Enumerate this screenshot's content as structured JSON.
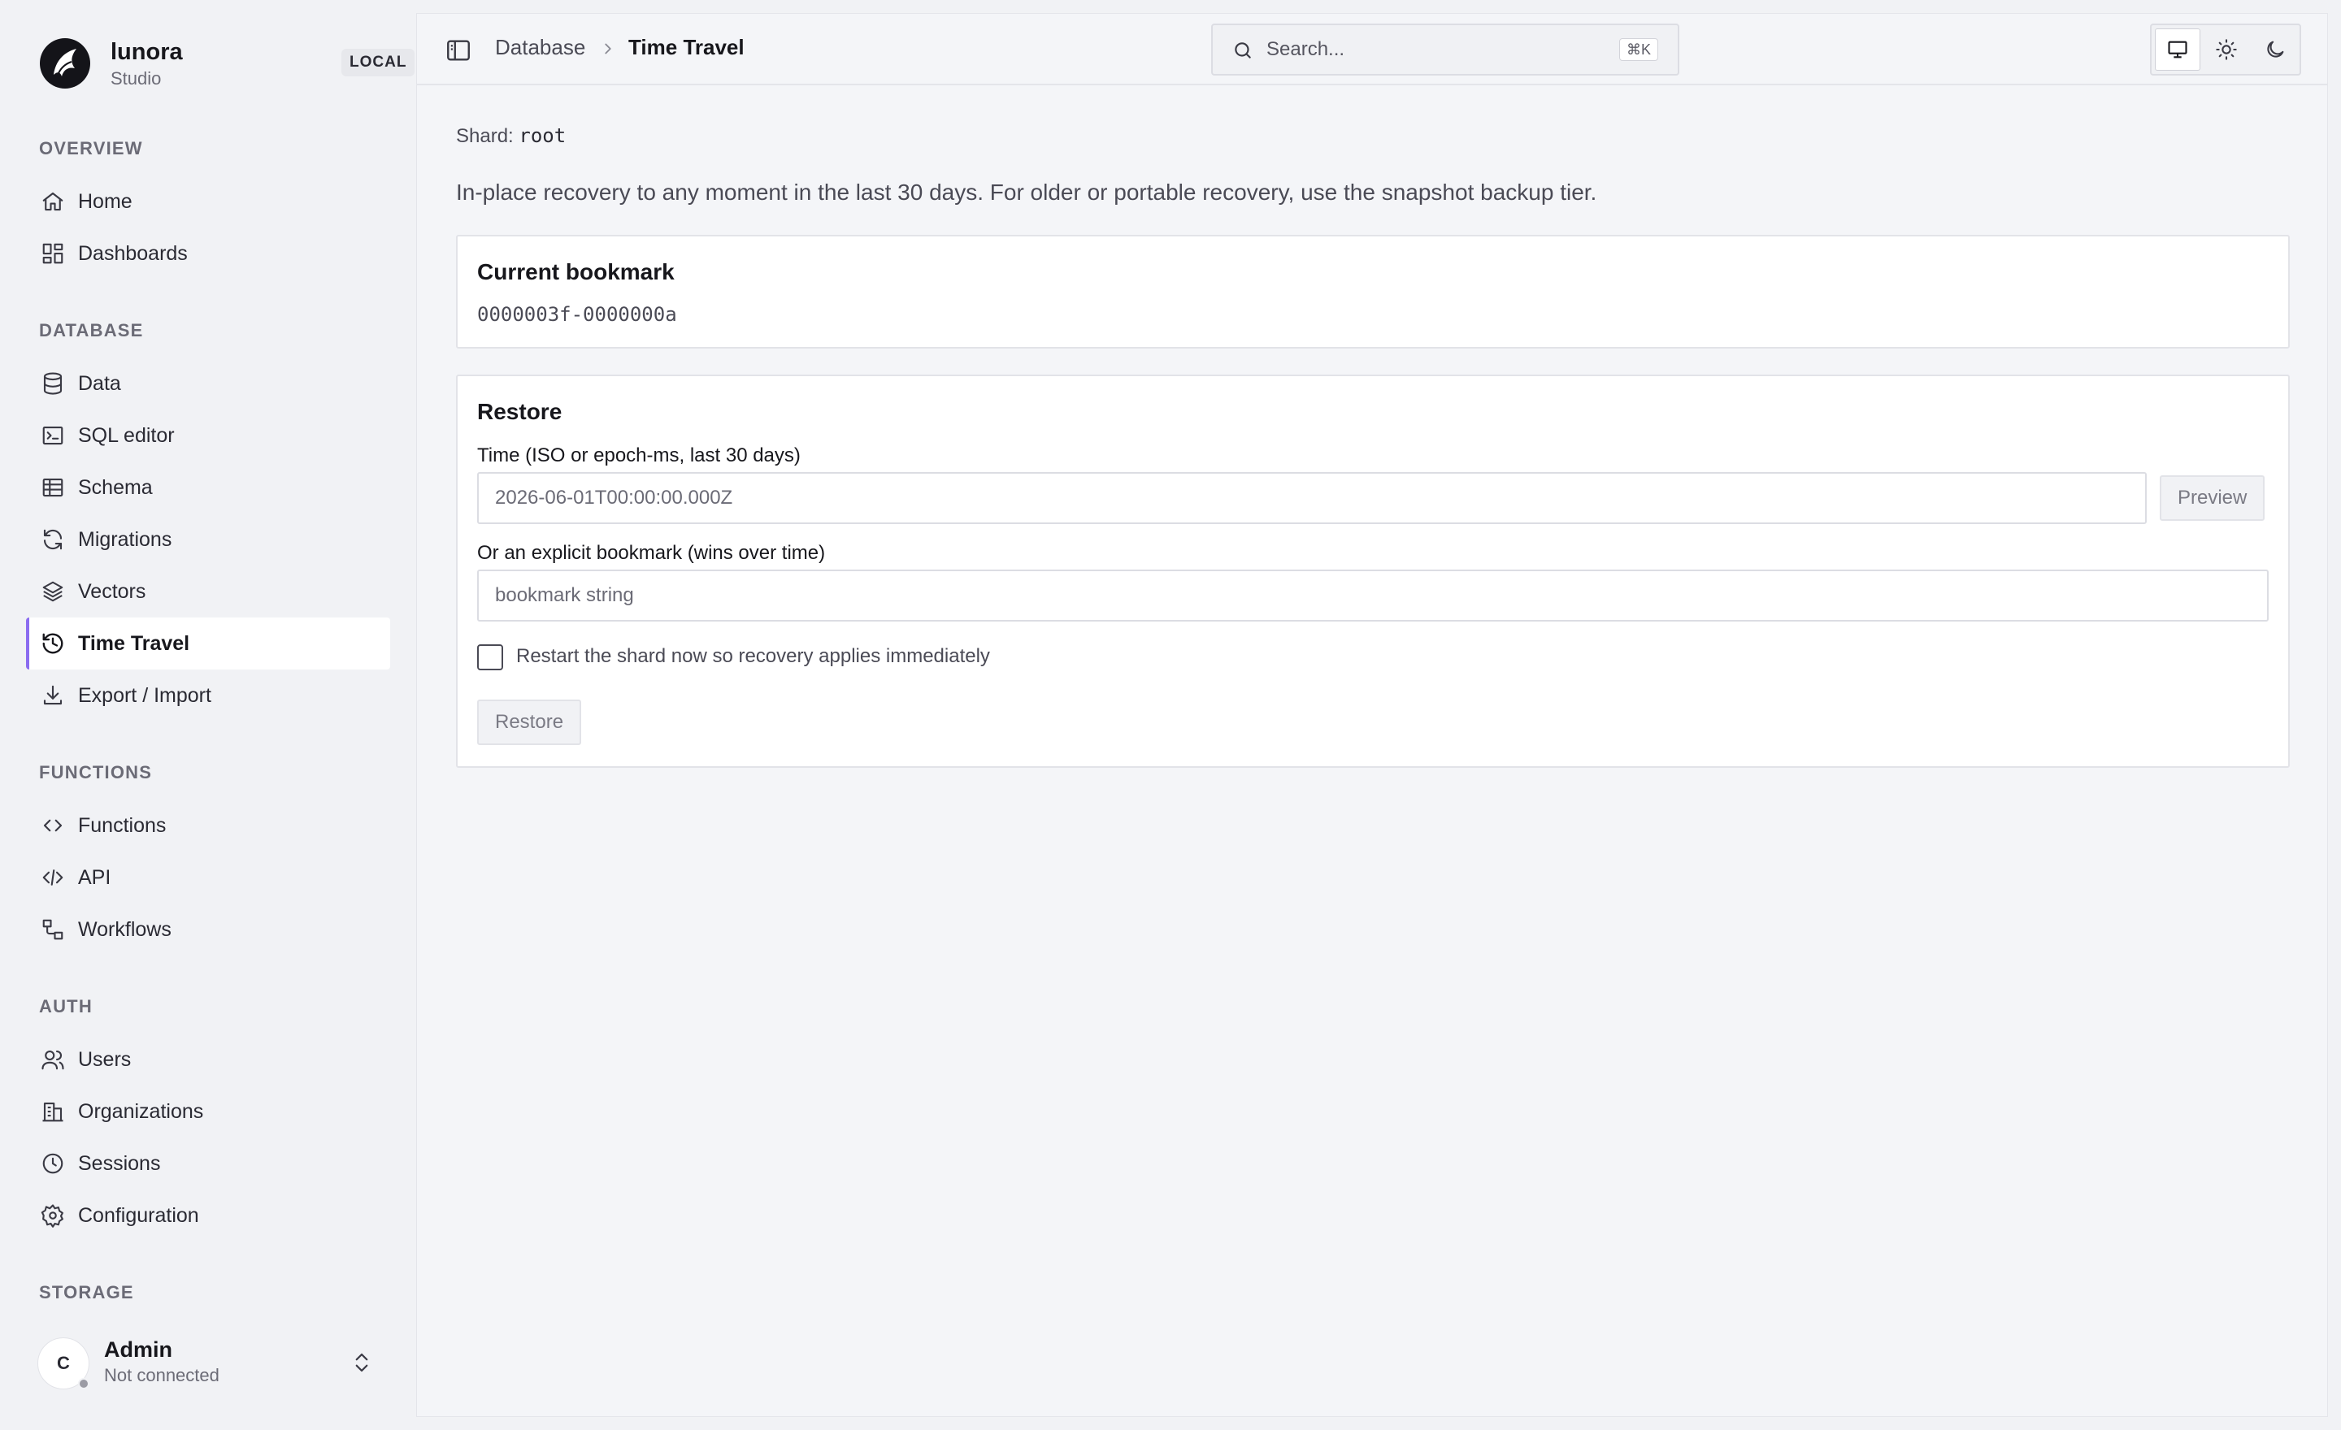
{
  "brand": {
    "name": "lunora",
    "subtitle": "Studio",
    "env_badge": "LOCAL"
  },
  "sidebar": {
    "sections": {
      "overview": "OVERVIEW",
      "database": "DATABASE",
      "functions": "FUNCTIONS",
      "auth": "AUTH",
      "storage": "STORAGE"
    },
    "items": [
      {
        "label": "Home",
        "icon": "home-icon"
      },
      {
        "label": "Dashboards",
        "icon": "dashboards-icon"
      },
      {
        "label": "Data",
        "icon": "database-icon"
      },
      {
        "label": "SQL editor",
        "icon": "terminal-icon"
      },
      {
        "label": "Schema",
        "icon": "table-icon"
      },
      {
        "label": "Migrations",
        "icon": "refresh-icon"
      },
      {
        "label": "Vectors",
        "icon": "layers-icon"
      },
      {
        "label": "Time Travel",
        "icon": "history-icon",
        "active": true
      },
      {
        "label": "Export / Import",
        "icon": "download-icon"
      },
      {
        "label": "Functions",
        "icon": "code-icon"
      },
      {
        "label": "API",
        "icon": "api-icon"
      },
      {
        "label": "Workflows",
        "icon": "workflow-icon"
      },
      {
        "label": "Users",
        "icon": "users-icon"
      },
      {
        "label": "Organizations",
        "icon": "building-icon"
      },
      {
        "label": "Sessions",
        "icon": "clock-icon"
      },
      {
        "label": "Configuration",
        "icon": "gear-icon"
      }
    ]
  },
  "user": {
    "initial": "C",
    "name": "Admin",
    "status": "Not connected"
  },
  "header": {
    "breadcrumb_parent": "Database",
    "breadcrumb_current": "Time Travel",
    "search_placeholder": "Search...",
    "search_shortcut": "⌘K",
    "theme_options": [
      "system",
      "light",
      "dark"
    ],
    "theme_selected": "system"
  },
  "page": {
    "shard_label": "Shard:",
    "shard_value": "root",
    "intro": "In-place recovery to any moment in the last 30 days. For older or portable recovery, use the snapshot backup tier.",
    "bookmark_card": {
      "title": "Current bookmark",
      "value": "0000003f-0000000a"
    },
    "restore_card": {
      "title": "Restore",
      "time_label": "Time (ISO or epoch-ms, last 30 days)",
      "time_placeholder": "2026-06-01T00:00:00.000Z",
      "preview_button": "Preview",
      "bookmark_label": "Or an explicit bookmark (wins over time)",
      "bookmark_placeholder": "bookmark string",
      "restart_label": "Restart the shard now so recovery applies immediately",
      "restart_checked": false,
      "restore_button": "Restore"
    }
  },
  "colors": {
    "accent": "#8b6cf0",
    "background": "#f1f2f5",
    "surface": "#ffffff"
  }
}
